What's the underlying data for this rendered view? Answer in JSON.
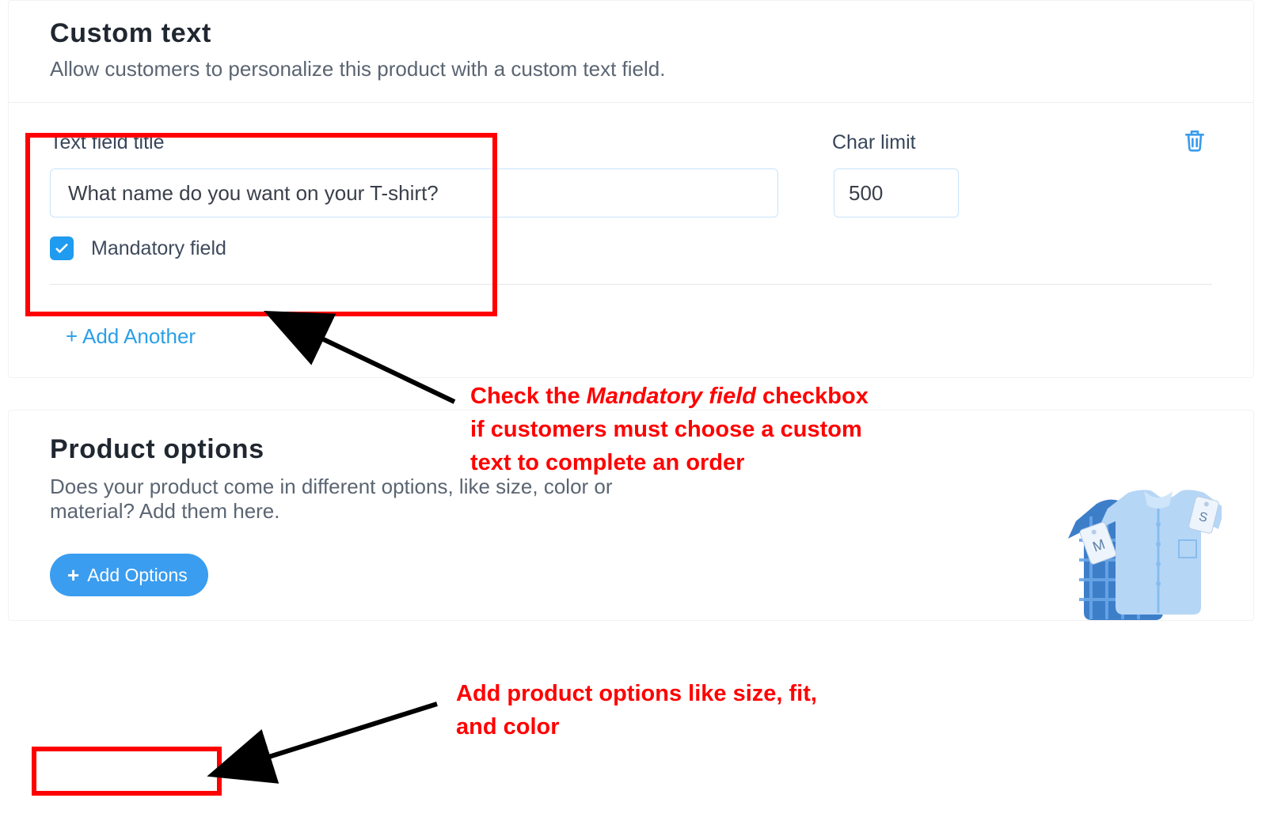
{
  "custom_text": {
    "heading": "Custom text",
    "subheading": "Allow customers to personalize this product with a custom text field.",
    "title_label": "Text field title",
    "title_value": "What name do you want on your T-shirt?",
    "char_limit_label": "Char limit",
    "char_limit_value": "500",
    "mandatory_checked": true,
    "mandatory_label": "Mandatory field",
    "add_another": "+ Add Another"
  },
  "product_options": {
    "heading": "Product options",
    "subheading": "Does your product come in different options, like size, color or material? Add them here.",
    "button_label": "Add Options"
  },
  "annotations": {
    "mandatory_pre": "Check the ",
    "mandatory_em": "Mandatory field",
    "mandatory_post": " checkbox if customers must choose a custom text to complete an order",
    "options": "Add product options like size, fit, and color"
  },
  "illustration": {
    "tag_front": "M",
    "tag_back": "S"
  }
}
